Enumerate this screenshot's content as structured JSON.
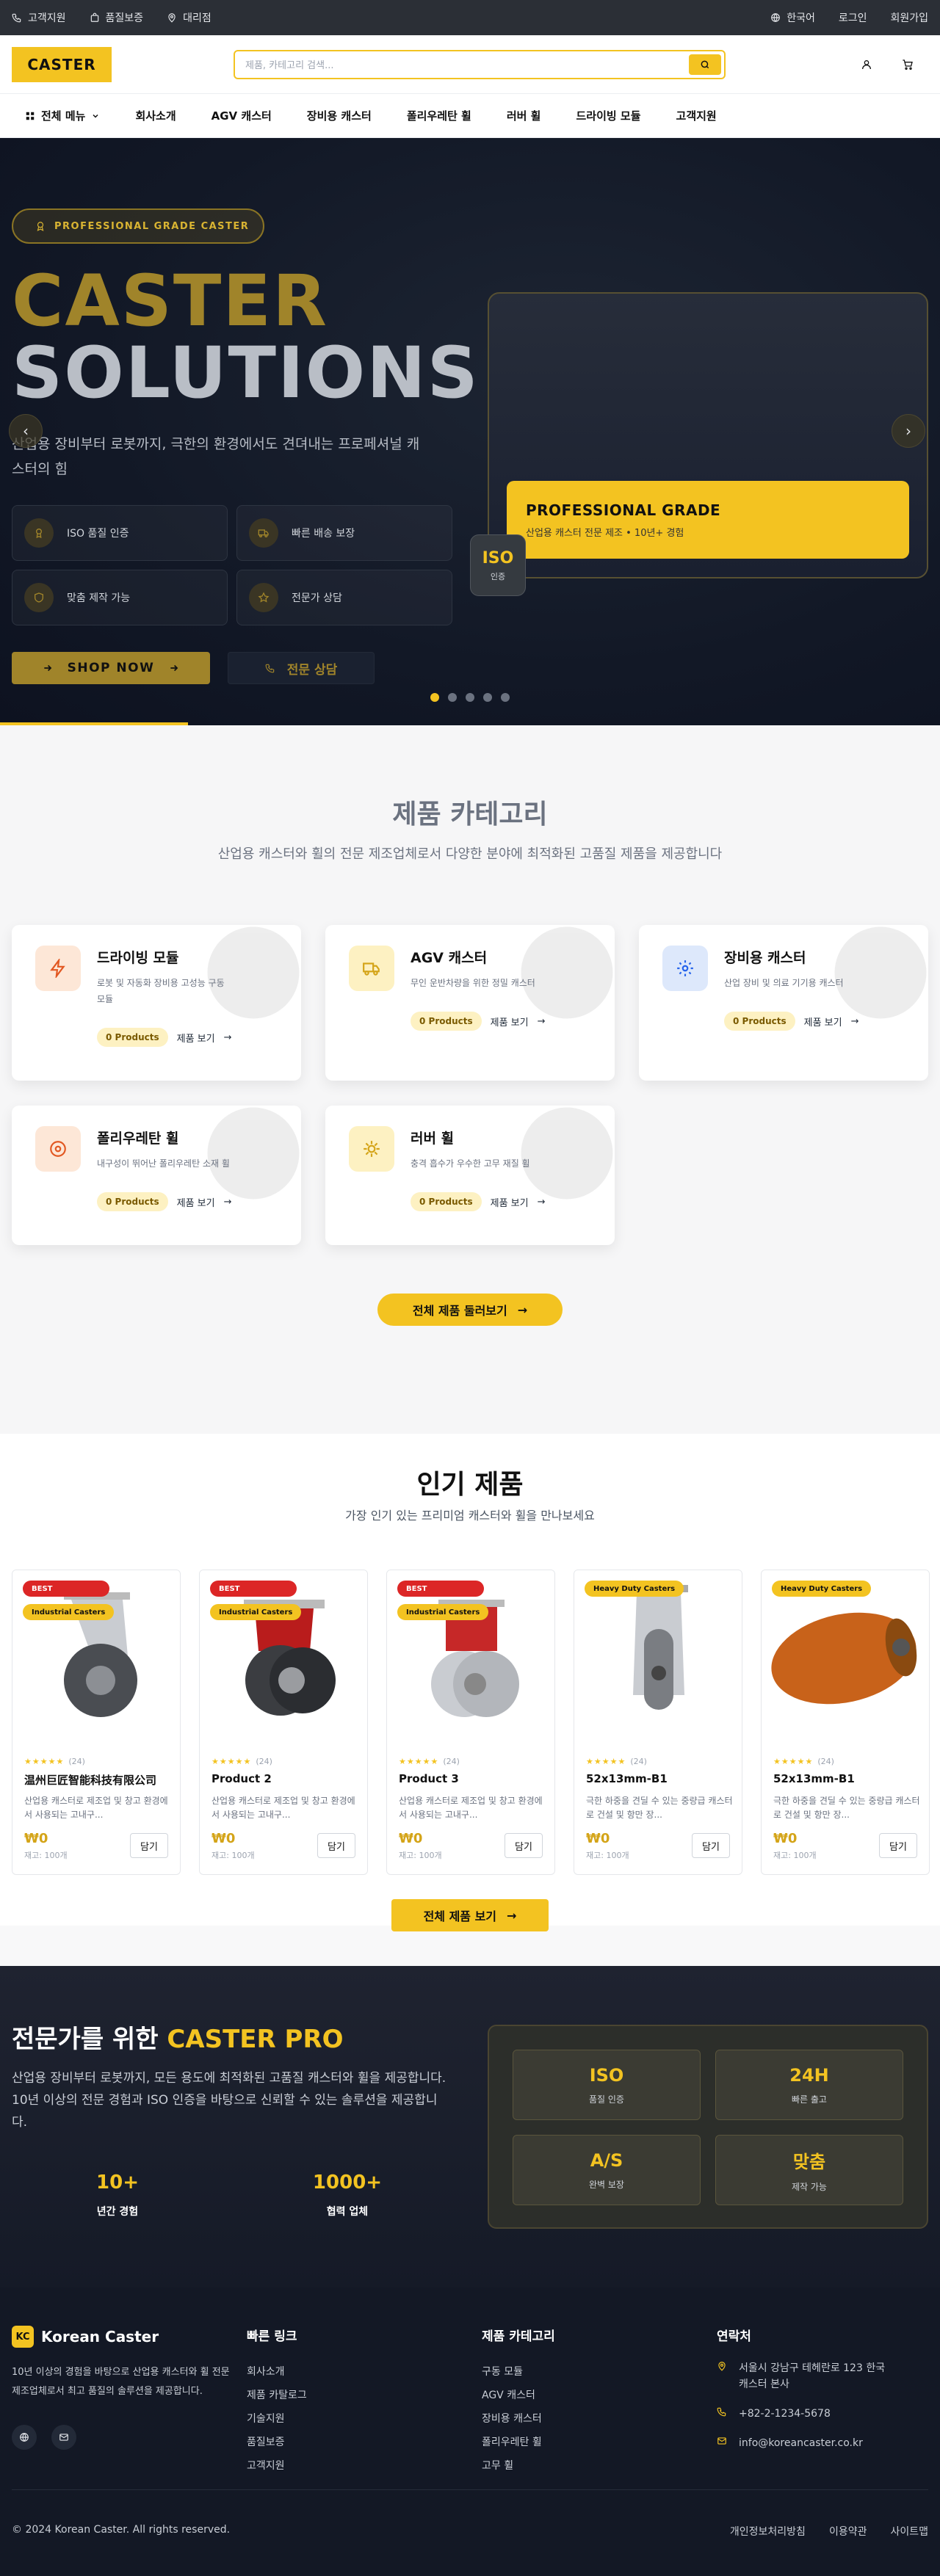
{
  "util": {
    "support": "고객지원",
    "warranty": "품질보증",
    "dealer": "대리점",
    "lang": "한국어",
    "login": "로그인",
    "signup": "회원가입"
  },
  "header": {
    "logo": "CASTER",
    "search_placeholder": "제품, 카테고리 검색..."
  },
  "nav": {
    "menu": "전체 메뉴",
    "items": [
      "회사소개",
      "AGV 캐스터",
      "장비용 캐스터",
      "폴리우레탄 휠",
      "러버 휠",
      "드라이빙 모듈",
      "고객지원"
    ]
  },
  "hero": {
    "badge": "PROFESSIONAL GRADE CASTER",
    "title1": "CASTER",
    "title2": "SOLUTIONS",
    "sub": "산업용 장비부터 로봇까지, 극한의 환경에서도 견뎌내는 프로페셔널 캐스터의 힘",
    "features": [
      "ISO 품질 인증",
      "빠른 배송 보장",
      "맞춤 제작 가능",
      "전문가 상담"
    ],
    "shop": "SHOP NOW",
    "consult": "전문 상담",
    "panel_title": "PROFESSIONAL GRADE",
    "panel_sub": "산업용 캐스터 전문 제조 • 10년+ 경험",
    "iso_top": "ISO",
    "iso_bottom": "인증"
  },
  "categories": {
    "title": "제품 카테고리",
    "sub": "산업용 캐스터와 휠의 전문 제조업체로서 다양한 분야에 최적화된 고품질 제품을 제공합니다",
    "items": [
      {
        "name": "드라이빙 모듈",
        "desc": "로봇 및 자동화 장비용 고성능 구동 모듈",
        "count": "0 Products",
        "view": "제품 보기"
      },
      {
        "name": "AGV 캐스터",
        "desc": "무인 운반차량을 위한 정밀 캐스터",
        "count": "0 Products",
        "view": "제품 보기"
      },
      {
        "name": "장비용 캐스터",
        "desc": "산업 장비 및 의료 기기용 캐스터",
        "count": "0 Products",
        "view": "제품 보기"
      },
      {
        "name": "폴리우레탄 휠",
        "desc": "내구성이 뛰어난 폴리우레탄 소재 휠",
        "count": "0 Products",
        "view": "제품 보기"
      },
      {
        "name": "러버 휠",
        "desc": "충격 흡수가 우수한 고무 재질 휠",
        "count": "0 Products",
        "view": "제품 보기"
      }
    ],
    "viewall": "전체 제품 둘러보기"
  },
  "products": {
    "title": "인기 제품",
    "sub": "가장 인기 있는 프리미엄 캐스터와 휠을 만나보세요",
    "items": [
      {
        "best": "BEST",
        "tag": "Industrial Casters",
        "stars": "★★★★★",
        "reviews": "(24)",
        "name": "温州巨匠智能科技有限公司",
        "desc": "산업용 캐스터로 제조업 및 창고 환경에서 사용되는 고내구...",
        "price": "₩0",
        "stock": "재고: 100개",
        "cart": "담기"
      },
      {
        "best": "BEST",
        "tag": "Industrial Casters",
        "stars": "★★★★★",
        "reviews": "(24)",
        "name": "Product 2",
        "desc": "산업용 캐스터로 제조업 및 창고 환경에서 사용되는 고내구...",
        "price": "₩0",
        "stock": "재고: 100개",
        "cart": "담기"
      },
      {
        "best": "BEST",
        "tag": "Industrial Casters",
        "stars": "★★★★★",
        "reviews": "(24)",
        "name": "Product 3",
        "desc": "산업용 캐스터로 제조업 및 창고 환경에서 사용되는 고내구...",
        "price": "₩0",
        "stock": "재고: 100개",
        "cart": "담기"
      },
      {
        "best": "",
        "tag": "Heavy Duty Casters",
        "stars": "★★★★★",
        "reviews": "(24)",
        "name": "52x13mm-B1",
        "desc": "극한 하중을 견딜 수 있는 중량급 캐스터로 건설 및 항만 장...",
        "price": "₩0",
        "stock": "재고: 100개",
        "cart": "담기"
      },
      {
        "best": "",
        "tag": "Heavy Duty Casters",
        "stars": "★★★★★",
        "reviews": "(24)",
        "name": "52x13mm-B1",
        "desc": "극한 하중을 견딜 수 있는 중량급 캐스터로 건설 및 항만 장...",
        "price": "₩0",
        "stock": "재고: 100개",
        "cart": "담기"
      }
    ],
    "viewall": "전체 제품 보기"
  },
  "pro": {
    "title_a": "전문가를 위한 ",
    "title_b": "CASTER PRO",
    "text": "산업용 장비부터 로봇까지, 모든 용도에 최적화된 고품질 캐스터와 휠을 제공합니다. 10년 이상의 전문 경험과 ISO 인증을 바탕으로 신뢰할 수 있는 솔루션을 제공합니다.",
    "stat1_n": "10+",
    "stat1_l": "년간 경험",
    "stat2_n": "1000+",
    "stat2_l": "협력 업체",
    "grid": [
      {
        "a": "ISO",
        "b": "품질 인증"
      },
      {
        "a": "24H",
        "b": "빠른 출고"
      },
      {
        "a": "A/S",
        "b": "완벽 보장"
      },
      {
        "a": "맞춤",
        "b": "제작 가능"
      }
    ]
  },
  "footer": {
    "brand_badge": "KC",
    "brand": "Korean Caster",
    "about": "10년 이상의 경험을 바탕으로 산업용 캐스터와 휠 전문 제조업체로서 최고 품질의 솔루션을 제공합니다.",
    "quick_title": "빠른 링크",
    "quick": [
      "회사소개",
      "제품 카탈로그",
      "기술지원",
      "품질보증",
      "고객지원"
    ],
    "cat_title": "제품 카테고리",
    "cats": [
      "구동 모듈",
      "AGV 캐스터",
      "장비용 캐스터",
      "폴리우레탄 휠",
      "고무 휠"
    ],
    "contact_title": "연락처",
    "address": "서울시 강남구 테헤란로 123 한국캐스터 본사",
    "phone": "+82-2-1234-5678",
    "email": "info@koreancaster.co.kr",
    "copy": "© 2024 Korean Caster. All rights reserved.",
    "links": [
      "개인정보처리방침",
      "이용약관",
      "사이트맵"
    ]
  },
  "colors": {
    "accent": "#f3c321",
    "dark": "#121826",
    "gold": "#a0842a",
    "price": "#d4a418"
  }
}
